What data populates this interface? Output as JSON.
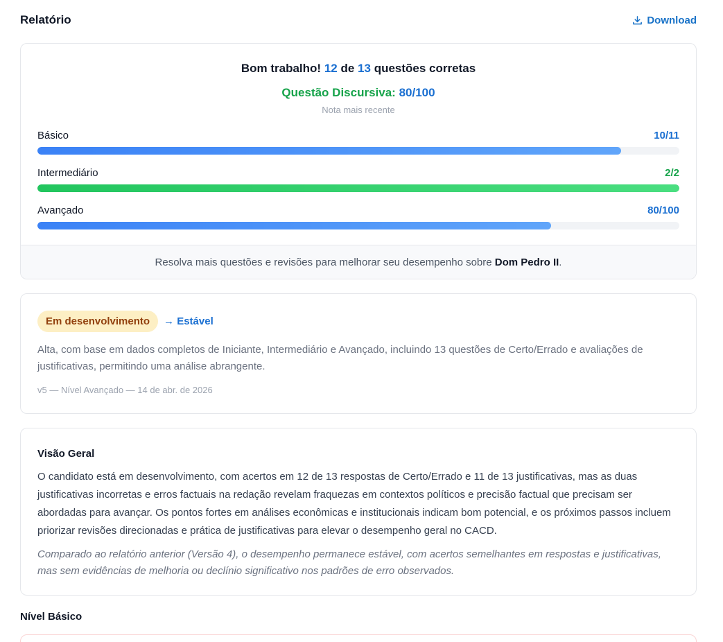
{
  "header": {
    "title": "Relatório",
    "download_label": "Download"
  },
  "score": {
    "headline_prefix": "Bom trabalho!",
    "correct": "12",
    "of_word": "de",
    "total": "13",
    "headline_suffix": "questões corretas",
    "discursive_label": "Questão Discursiva:",
    "discursive_value": "80/100",
    "recent_note": "Nota mais recente",
    "levels": [
      {
        "name": "Básico",
        "score": "10/11",
        "fraction": 0.909,
        "color": "blue"
      },
      {
        "name": "Intermediário",
        "score": "2/2",
        "fraction": 1.0,
        "color": "green"
      },
      {
        "name": "Avançado",
        "score": "80/100",
        "fraction": 0.8,
        "color": "blue"
      }
    ],
    "footer_prefix": "Resolva mais questões e revisões para melhorar seu desempenho sobre",
    "footer_topic": "Dom Pedro II",
    "footer_suffix": "."
  },
  "status": {
    "badge": "Em desenvolvimento",
    "next": "→ Estável",
    "description": "Alta, com base em dados completos de Iniciante, Intermediário e Avançado, incluindo 13 questões de Certo/Errado e avaliações de justificativas, permitindo uma análise abrangente.",
    "meta": "v5 — Nível Avançado — 14 de abr. de 2026"
  },
  "overview": {
    "title": "Visão Geral",
    "body": "O candidato está em desenvolvimento, com acertos em 12 de 13 respostas de Certo/Errado e 11 de 13 justificativas, mas as duas justificativas incorretas e erros factuais na redação revelam fraquezas em contextos políticos e precisão factual que precisam ser abordadas para avançar. Os pontos fortes em análises econômicas e institucionais indicam bom potencial, e os próximos passos incluem priorizar revisões direcionadas e prática de justificativas para elevar o desempenho geral no CACD.",
    "comparison": "Comparado ao relatório anterior (Versão 4), o desempenho permanece estável, com acertos semelhantes em respostas e justificativas, mas sem evidências de melhoria ou declínio significativo nos padrões de erro observados."
  },
  "sections": {
    "basic_title": "Nível Básico"
  },
  "colors": {
    "accent_blue": "#1a6fd1",
    "success_green": "#16a34a",
    "badge_bg": "#fdefc4",
    "badge_text": "#92400e"
  }
}
